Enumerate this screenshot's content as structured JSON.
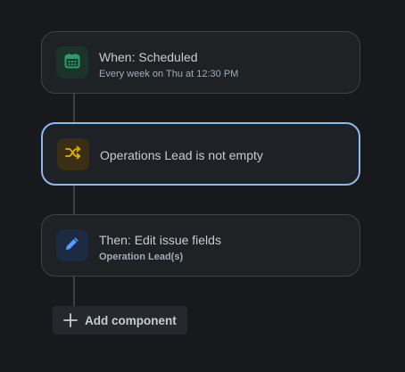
{
  "trigger": {
    "title": "When: Scheduled",
    "subtitle": "Every week on Thu at 12:30 PM",
    "icon": "calendar-icon",
    "icon_color": "#22a06b",
    "tile_color": "#1c3329"
  },
  "condition": {
    "title": "Operations Lead is not empty",
    "icon": "shuffle-icon",
    "icon_color": "#e2b203",
    "tile_color": "#3a2f14",
    "selected": true,
    "selected_border_color": "#8fb8ee"
  },
  "action": {
    "title": "Then: Edit issue fields",
    "subtitle": "Operation Lead(s)",
    "icon": "pencil-icon",
    "icon_color": "#579dff",
    "tile_color": "#1c2b41"
  },
  "add_component": {
    "label": "Add component",
    "icon": "plus-icon"
  }
}
